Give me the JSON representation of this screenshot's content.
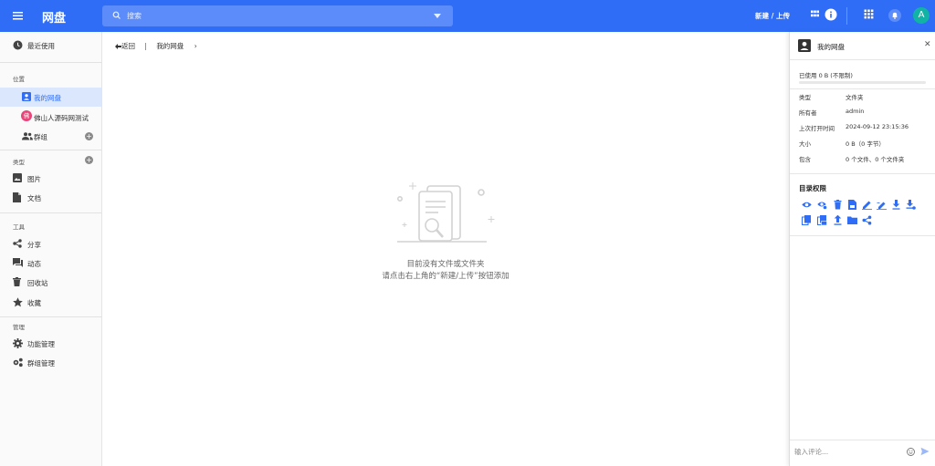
{
  "topbar": {
    "title": "网盘",
    "search_placeholder": "搜索",
    "upload_label": "新建 / 上传",
    "avatar_letter": "A",
    "color": "#2f6df6"
  },
  "sidebar": {
    "recent": "最近使用",
    "location_header": "位置",
    "my_drive": "我的网盘",
    "shared_drive_badge": "佛",
    "shared_drive": "佛山人源码网测试",
    "groups": "群组",
    "types_header": "类型",
    "images": "图片",
    "documents": "文档",
    "tools_header": "工具",
    "share": "分享",
    "activity": "动态",
    "trash": "回收站",
    "favorites": "收藏",
    "admin_header": "管理",
    "function_mgmt": "功能管理",
    "group_mgmt": "群组管理"
  },
  "breadcrumb": {
    "back": "返回",
    "separator": "|",
    "current": "我的网盘"
  },
  "empty_state": {
    "line1": "目前没有文件或文件夹",
    "line2": "请点击右上角的“新建/上传”按钮添加"
  },
  "panel": {
    "title": "我的网盘",
    "usage": "已使用 0 B (不限制)",
    "usage_fraction": 0,
    "props": [
      {
        "k": "类型",
        "v": "文件夹"
      },
      {
        "k": "所有者",
        "v": "admin"
      },
      {
        "k": "上次打开时间",
        "v": "2024-09-12 23:15:36"
      },
      {
        "k": "大小",
        "v": "0 B（0 字节）"
      },
      {
        "k": "包含",
        "v": "0 个文件、0 个文件夹"
      }
    ],
    "permissions_title": "目录权限",
    "comment_placeholder": "输入评论..."
  }
}
